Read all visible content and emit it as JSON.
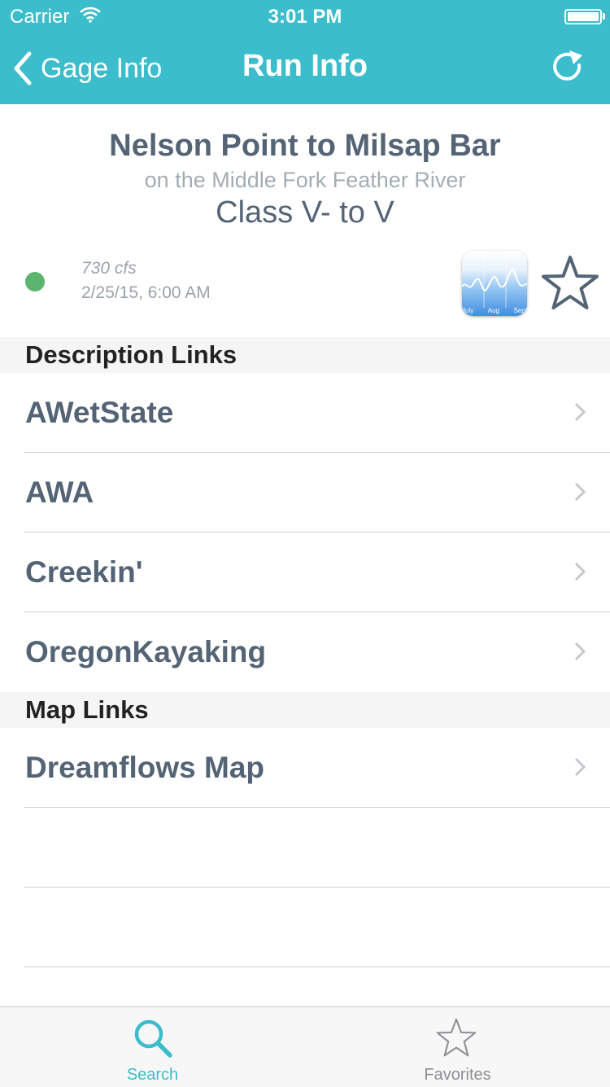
{
  "status_bar": {
    "carrier": "Carrier",
    "time": "3:01 PM"
  },
  "nav": {
    "back_label": "Gage Info",
    "title": "Run Info"
  },
  "run": {
    "name": "Nelson Point to Milsap Bar",
    "river": "on the Middle Fork Feather River",
    "class": "Class V- to V",
    "flow": "730 cfs",
    "updated": "2/25/15, 6:00 AM",
    "status_color": "#5cb56e",
    "graph_months": [
      "July",
      "Aug",
      "Sept"
    ]
  },
  "sections": {
    "description": {
      "title": "Description Links",
      "items": [
        {
          "label": "AWetState"
        },
        {
          "label": "AWA"
        },
        {
          "label": "Creekin'"
        },
        {
          "label": "OregonKayaking"
        }
      ]
    },
    "map": {
      "title": "Map Links",
      "items": [
        {
          "label": "Dreamflows Map"
        }
      ]
    }
  },
  "tabs": [
    {
      "label": "Search",
      "icon": "search-icon",
      "selected": true
    },
    {
      "label": "Favorites",
      "icon": "star-icon",
      "selected": false
    }
  ],
  "colors": {
    "accent": "#3bbdcb",
    "text": "#546475",
    "muted": "#a4adb5",
    "status_green": "#5cb56e",
    "tab_inactive": "#8e8e93"
  }
}
